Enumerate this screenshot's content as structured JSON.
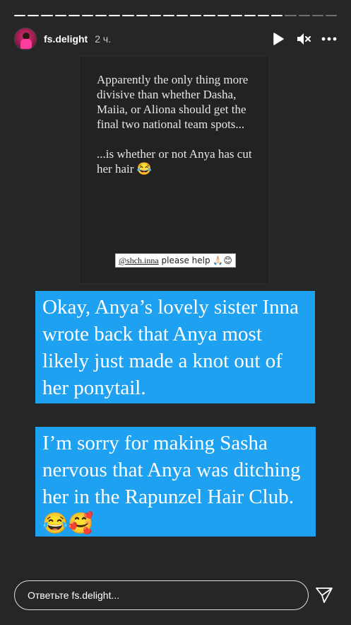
{
  "header": {
    "username": "fs.delight",
    "time": "2 ч."
  },
  "progress": {
    "segments_total": 24,
    "segments_viewed": 20
  },
  "story": {
    "card_text": "Apparently the only thing more divisive than whether Dasha, Maiia, or Aliona should get the final two national team spots...\n\n...is whether or not Anya has cut her hair 😂",
    "mention_handle": "@shch.inna",
    "mention_text": " please help 🙏🏻😊"
  },
  "captions": [
    "Okay, Anya’s lovely sister Inna wrote back that Anya most likely just made a knot out of her ponytail.",
    "I’m sorry for making Sasha nervous that Anya was ditching her in the Rapunzel Hair Club. 😂🥰"
  ],
  "reply": {
    "placeholder": "Ответьте fs.delight..."
  },
  "icons": {
    "play": "play-icon",
    "mute": "mute-icon",
    "more": "more-icon",
    "send": "send-icon"
  },
  "colors": {
    "caption_bg": "#1fa1f2",
    "story_bg": "#262626"
  }
}
